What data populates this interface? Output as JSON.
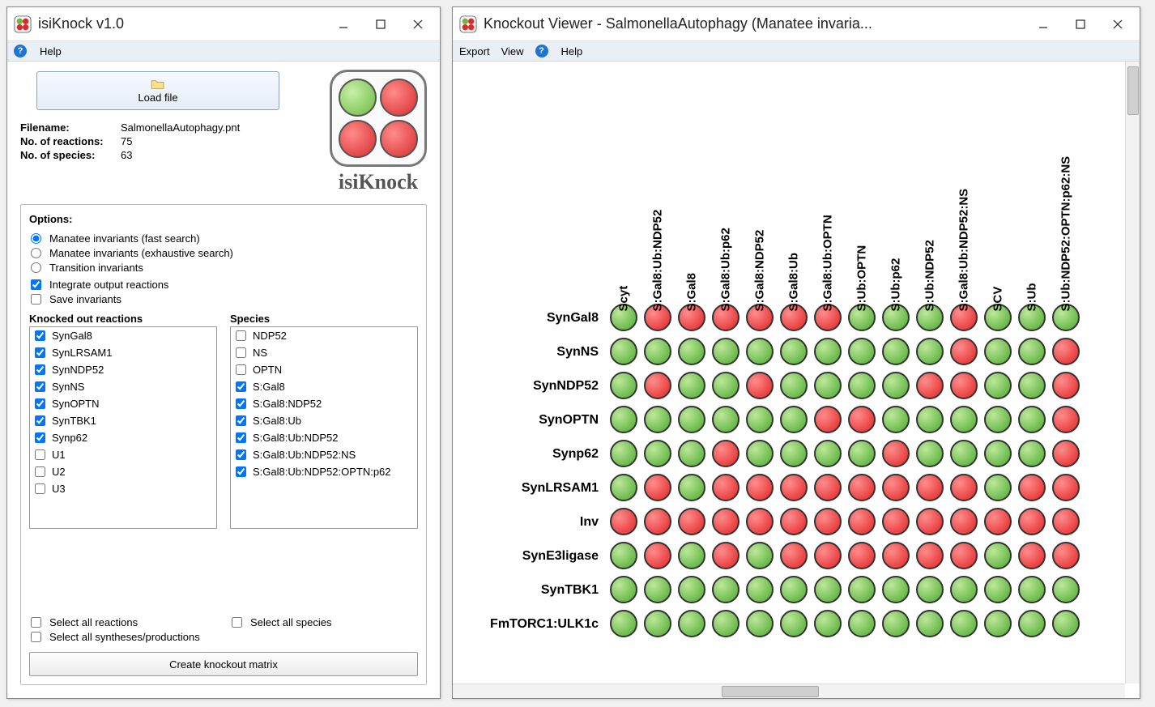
{
  "left": {
    "title": "isiKnock v1.0",
    "menu": {
      "help": "Help"
    },
    "load_btn": "Load file",
    "info": {
      "filename_lbl": "Filename:",
      "filename": "SalmonellaAutophagy.pnt",
      "reactions_lbl": "No. of reactions:",
      "reactions": "75",
      "species_lbl": "No. of species:",
      "species": "63"
    },
    "brand": "isiKnock",
    "options_label": "Options:",
    "radios": [
      {
        "label": "Manatee invariants (fast search)",
        "checked": true
      },
      {
        "label": "Manatee invariants (exhaustive search)",
        "checked": false
      },
      {
        "label": "Transition invariants",
        "checked": false
      }
    ],
    "checks": [
      {
        "label": "Integrate output reactions",
        "checked": true
      },
      {
        "label": "Save invariants",
        "checked": false
      }
    ],
    "reactions_head": "Knocked out reactions",
    "species_head": "Species",
    "reactions_list": [
      {
        "label": "SynGal8",
        "checked": true
      },
      {
        "label": "SynLRSAM1",
        "checked": true
      },
      {
        "label": "SynNDP52",
        "checked": true
      },
      {
        "label": "SynNS",
        "checked": true
      },
      {
        "label": "SynOPTN",
        "checked": true
      },
      {
        "label": "SynTBK1",
        "checked": true
      },
      {
        "label": "Synp62",
        "checked": true
      },
      {
        "label": "U1",
        "checked": false
      },
      {
        "label": "U2",
        "checked": false
      },
      {
        "label": "U3",
        "checked": false
      }
    ],
    "species_list": [
      {
        "label": "NDP52",
        "checked": false
      },
      {
        "label": "NS",
        "checked": false
      },
      {
        "label": "OPTN",
        "checked": false
      },
      {
        "label": "S:Gal8",
        "checked": true
      },
      {
        "label": "S:Gal8:NDP52",
        "checked": true
      },
      {
        "label": "S:Gal8:Ub",
        "checked": true
      },
      {
        "label": "S:Gal8:Ub:NDP52",
        "checked": true
      },
      {
        "label": "S:Gal8:Ub:NDP52:NS",
        "checked": true
      },
      {
        "label": "S:Gal8:Ub:NDP52:OPTN:p62",
        "checked": true
      }
    ],
    "select_all_reactions": "Select all reactions",
    "select_all_species": "Select all species",
    "select_all_synth": "Select all syntheses/productions",
    "create_btn": "Create knockout matrix"
  },
  "right": {
    "title": "Knockout Viewer - SalmonellaAutophagy (Manatee invaria...",
    "menu": {
      "export": "Export",
      "view": "View",
      "help": "Help"
    },
    "cols": [
      "Scyt",
      "S:Gal8:Ub:NDP52",
      "S:Gal8",
      "S:Gal8:Ub:p62",
      "S:Gal8:NDP52",
      "S:Gal8:Ub",
      "S:Gal8:Ub:OPTN",
      "S:Ub:OPTN",
      "S:Ub:p62",
      "S:Ub:NDP52",
      "S:Gal8:Ub:NDP52:NS",
      "SCV",
      "S:Ub",
      "S:Ub:NDP52:OPTN:p62:NS"
    ],
    "rows": [
      "SynGal8",
      "SynNS",
      "SynNDP52",
      "SynOPTN",
      "Synp62",
      "SynLRSAM1",
      "Inv",
      "SynE3ligase",
      "SynTBK1",
      "FmTORC1:ULK1c"
    ],
    "cells": [
      [
        0,
        1,
        1,
        1,
        1,
        1,
        1,
        0,
        0,
        0,
        1,
        0,
        0,
        0
      ],
      [
        0,
        0,
        0,
        0,
        0,
        0,
        0,
        0,
        0,
        0,
        1,
        0,
        0,
        1
      ],
      [
        0,
        1,
        0,
        0,
        1,
        0,
        0,
        0,
        0,
        1,
        1,
        0,
        0,
        1
      ],
      [
        0,
        0,
        0,
        0,
        0,
        0,
        1,
        1,
        0,
        0,
        0,
        0,
        0,
        1
      ],
      [
        0,
        0,
        0,
        1,
        0,
        0,
        0,
        0,
        1,
        0,
        0,
        0,
        0,
        1
      ],
      [
        0,
        1,
        0,
        1,
        1,
        1,
        1,
        1,
        1,
        1,
        1,
        0,
        1,
        1
      ],
      [
        1,
        1,
        1,
        1,
        1,
        1,
        1,
        1,
        1,
        1,
        1,
        1,
        1,
        1
      ],
      [
        0,
        1,
        0,
        1,
        0,
        1,
        1,
        1,
        1,
        1,
        1,
        0,
        1,
        1
      ],
      [
        0,
        0,
        0,
        0,
        0,
        0,
        0,
        0,
        0,
        0,
        0,
        0,
        0,
        0
      ],
      [
        0,
        0,
        0,
        0,
        0,
        0,
        0,
        0,
        0,
        0,
        0,
        0,
        0,
        0
      ]
    ]
  }
}
